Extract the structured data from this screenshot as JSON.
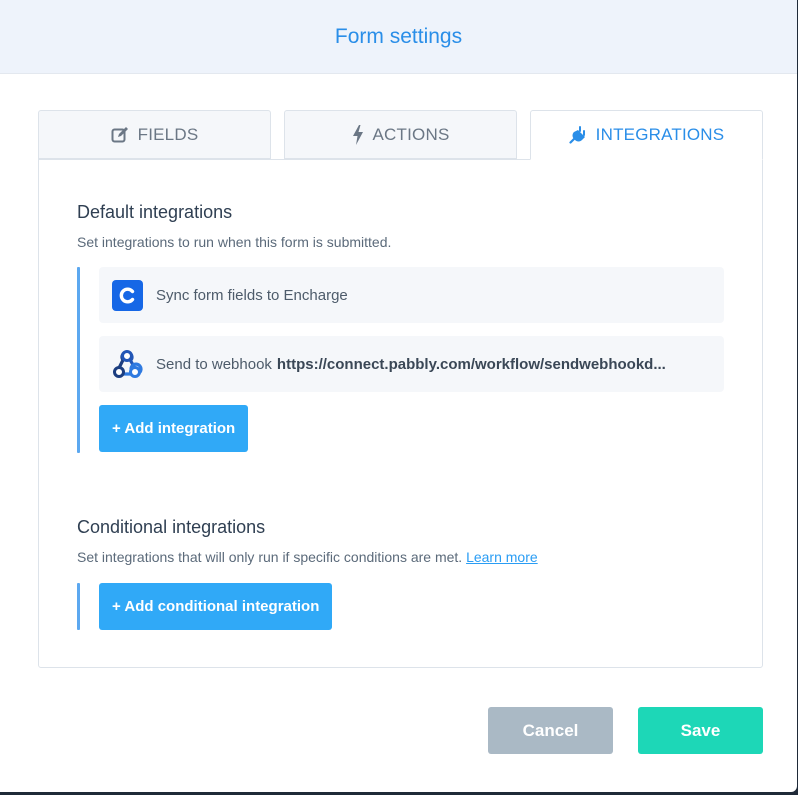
{
  "modal": {
    "title": "Form settings"
  },
  "tabs": [
    {
      "label": "FIELDS",
      "icon": "edit-icon",
      "active": false
    },
    {
      "label": "ACTIONS",
      "icon": "bolt-icon",
      "active": false
    },
    {
      "label": "INTEGRATIONS",
      "icon": "plug-icon",
      "active": true
    }
  ],
  "default_integrations": {
    "title": "Default integrations",
    "description": "Set integrations to run when this form is submitted.",
    "items": [
      {
        "icon": "encharge-logo",
        "text": "Sync form fields to Encharge",
        "url": ""
      },
      {
        "icon": "webhook-icon",
        "text": "Send to webhook",
        "url": "https://connect.pabbly.com/workflow/sendwebhookd..."
      }
    ],
    "add_button": "+ Add integration"
  },
  "conditional_integrations": {
    "title": "Conditional integrations",
    "description": "Set integrations that will only run if specific conditions are met.",
    "learn_more": "Learn more",
    "add_button": "+ Add conditional integration"
  },
  "footer": {
    "cancel": "Cancel",
    "save": "Save"
  },
  "colors": {
    "accent": "#2a8ee8",
    "primary_button": "#30a9f7",
    "save_button": "#1dd7b7",
    "cancel_button": "#aab9c5",
    "encharge_brand": "#1667e6"
  }
}
